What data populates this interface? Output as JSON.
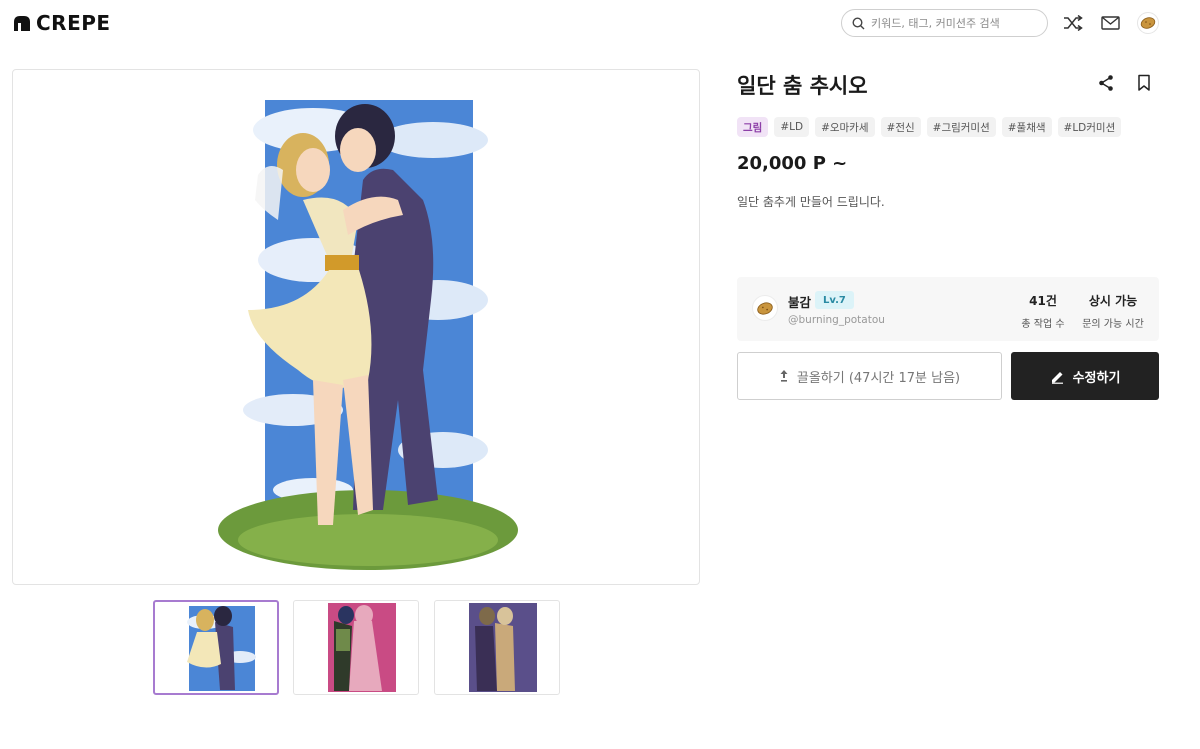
{
  "header": {
    "logo_text": "CREPE",
    "search_placeholder": "키워드, 태그, 커미션주 검색"
  },
  "product": {
    "title": "일단 춤 추시오",
    "tags": [
      "그림",
      "#LD",
      "#오마카세",
      "#전신",
      "#그림커미션",
      "#풀채색",
      "#LD커미션"
    ],
    "price": "20,000 P ~",
    "description": "일단 춤추게 만들어 드립니다."
  },
  "artist": {
    "name": "불감",
    "level": "Lv.7",
    "handle": "@burning_potatou",
    "stats": [
      {
        "value": "41건",
        "label": "총 작업 수"
      },
      {
        "value": "상시 가능",
        "label": "문의 가능 시간"
      }
    ]
  },
  "actions": {
    "pull_label": "끌올하기 (47시간 17분 남음)",
    "edit_label": "수정하기"
  },
  "gallery": {
    "thumbnail_count": 3,
    "active_index": 0
  },
  "colors": {
    "accent": "#a77bd0",
    "tag_primary_bg": "#f1e3f6",
    "tag_primary_fg": "#8d3fa8",
    "level_bg": "#dcf3f8",
    "dark_button": "#222222"
  }
}
